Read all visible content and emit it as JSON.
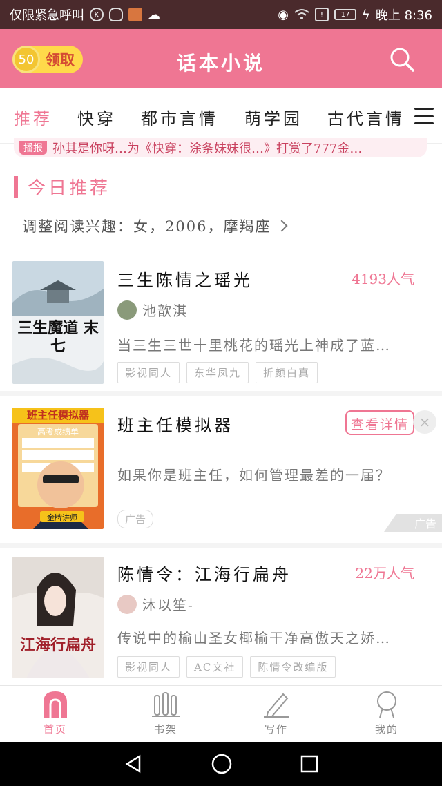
{
  "status_bar": {
    "carrier": "仅限紧急呼叫",
    "battery": "17",
    "time": "晚上 8:36"
  },
  "header": {
    "coins": "50",
    "claim_label": "领取",
    "title": "话本小说"
  },
  "tabs": [
    "推荐",
    "快穿",
    "都市言情",
    "萌学园",
    "古代言情"
  ],
  "marquee": {
    "badge": "播报",
    "text": "孙其是你呀…为《快穿：涂条妹妹很…》打赏了777金…"
  },
  "section": {
    "title": "今日推荐",
    "interest": "调整阅读兴趣：女，2006，摩羯座"
  },
  "books": [
    {
      "title": "三生陈情之瑶光",
      "popularity": "4193人气",
      "author": "池歆淇",
      "desc": "当三生三世十里桃花的瑶光上神成了蓝…",
      "tags": [
        "影视同人",
        "东华凤九",
        "折颜白真"
      ],
      "cover_text": "三生魔道 末七"
    },
    {
      "title": "班主任模拟器",
      "detail_label": "查看详情",
      "desc": "如果你是班主任，如何管理最差的一届？",
      "ad_label": "广告",
      "ad_corner": "广告",
      "cover_banner": "班主任模拟器",
      "cover_sub": "高考成绩单",
      "cover_footer": "金牌讲师"
    },
    {
      "title": "陈情令：江海行扁舟",
      "popularity": "22万人气",
      "author": "沐以笙-",
      "desc": "传说中的榆山圣女椰榆干净高傲天之娇…",
      "tags": [
        "影视同人",
        "AC文社",
        "陈情令改编版"
      ],
      "cover_text": "江海行扁舟"
    }
  ],
  "bottom_nav": [
    "首页",
    "书架",
    "写作",
    "我的"
  ],
  "colors": {
    "accent": "#ef7693",
    "status_bar": "#4a2a2c",
    "coin": "#ffd94a"
  }
}
